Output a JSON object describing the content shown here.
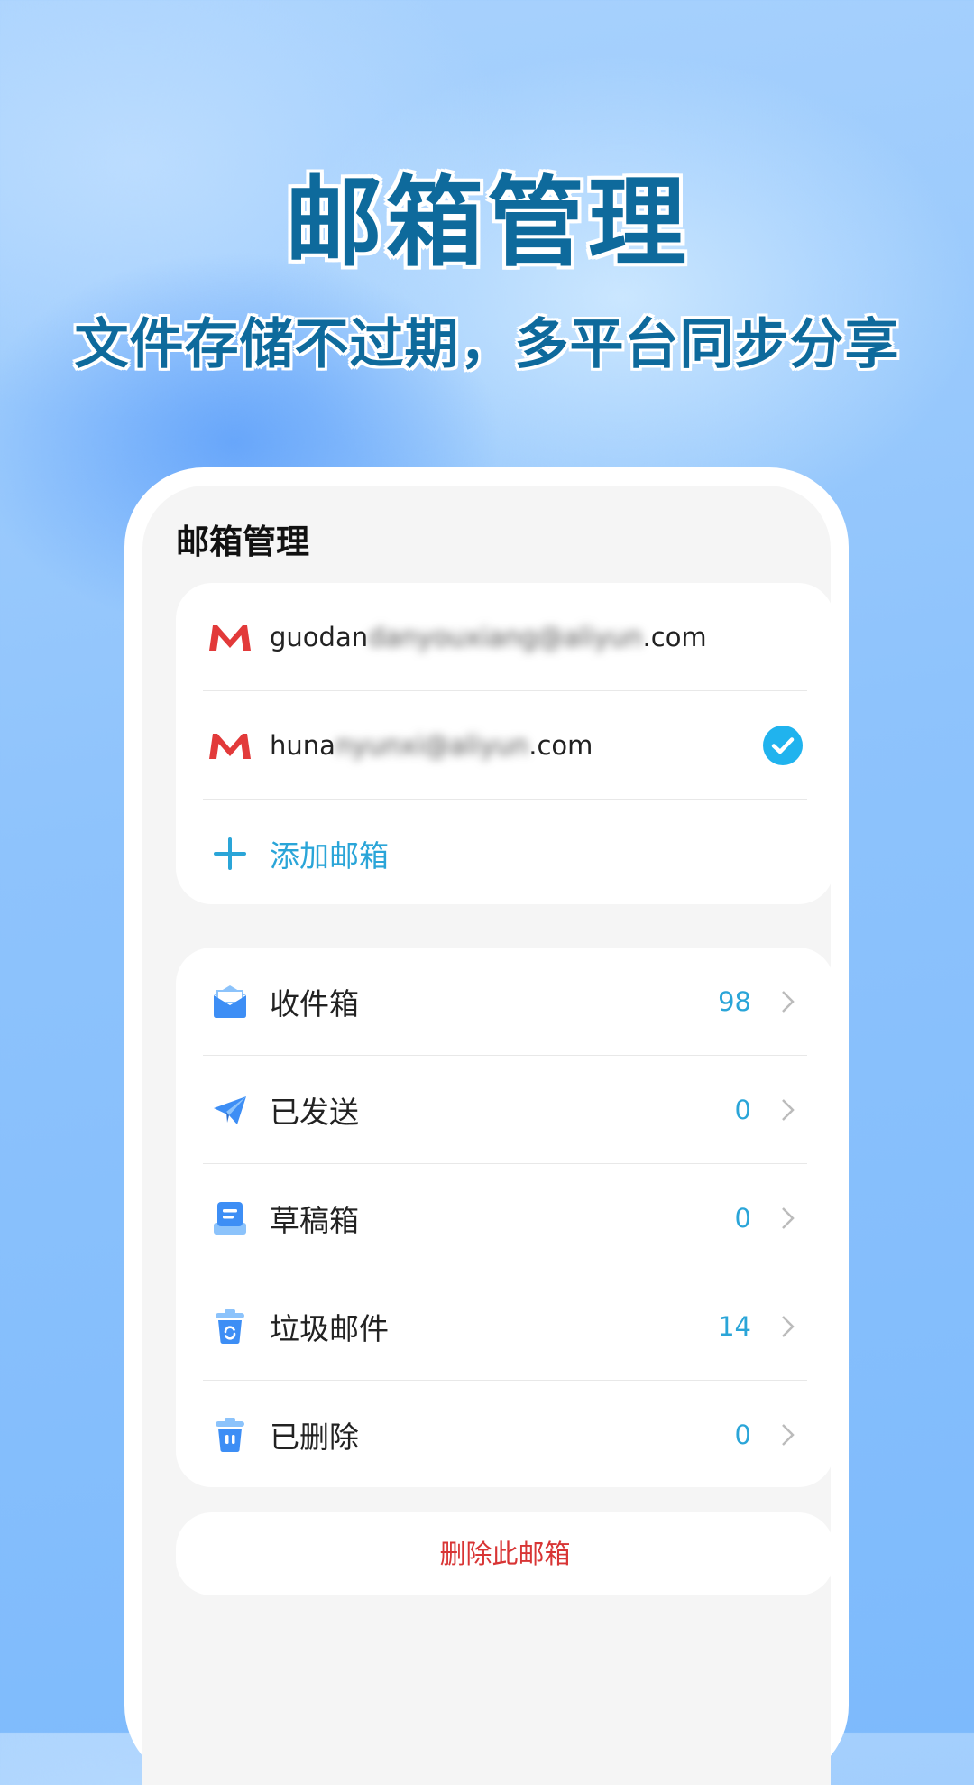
{
  "hero": {
    "title": "邮箱管理",
    "subtitle": "文件存储不过期，多平台同步分享"
  },
  "screen": {
    "title": "邮箱管理",
    "accounts": [
      {
        "prefix": "guodan",
        "hidden": "danyouxiang@aliyun",
        "suffix": ".com",
        "icon": "gmail-m-icon",
        "selected": false
      },
      {
        "prefix": "huna",
        "hidden": "nyunxi@aliyun",
        "suffix": ".com",
        "icon": "gmail-m-icon",
        "selected": true
      }
    ],
    "add_account_label": "添加邮箱",
    "folders": [
      {
        "label": "收件箱",
        "count": "98",
        "icon": "inbox-icon"
      },
      {
        "label": "已发送",
        "count": "0",
        "icon": "sent-icon"
      },
      {
        "label": "草稿箱",
        "count": "0",
        "icon": "drafts-icon"
      },
      {
        "label": "垃圾邮件",
        "count": "14",
        "icon": "spam-icon"
      },
      {
        "label": "已删除",
        "count": "0",
        "icon": "trash-icon"
      }
    ],
    "delete_label": "删除此邮箱"
  },
  "colors": {
    "accent": "#2aa5d8",
    "title_blue": "#0e6a9c",
    "danger": "#d83535",
    "mail_red": "#e23a3a",
    "icon_blue": "#3d8ef5",
    "check_blue": "#20b3ee"
  }
}
